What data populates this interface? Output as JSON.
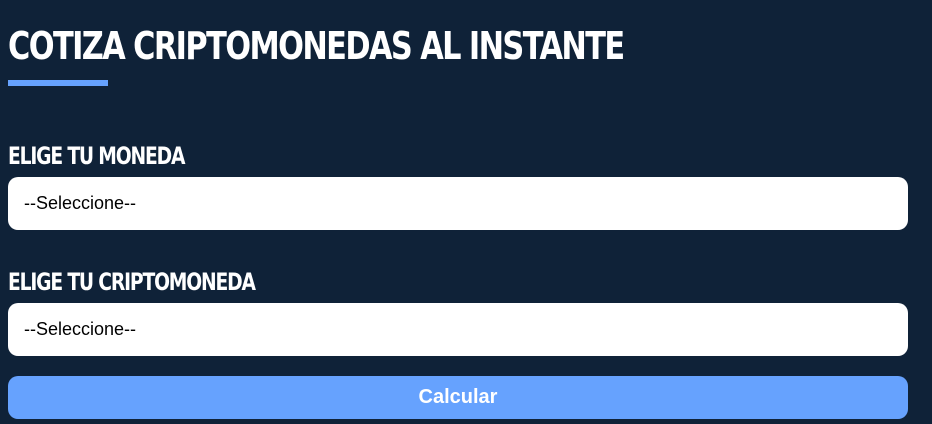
{
  "header": {
    "title": "COTIZA CRIPTOMONEDAS AL INSTANTE"
  },
  "form": {
    "currency": {
      "label": "ELIGE TU MONEDA",
      "selected": "--Seleccione--"
    },
    "crypto": {
      "label": "ELIGE TU CRIPTOMONEDA",
      "selected": "--Seleccione--"
    },
    "submit_label": "Calcular"
  },
  "colors": {
    "background": "#0f2238",
    "accent": "#66a2fe",
    "field_background": "#ffffff",
    "text_light": "#ffffff"
  }
}
